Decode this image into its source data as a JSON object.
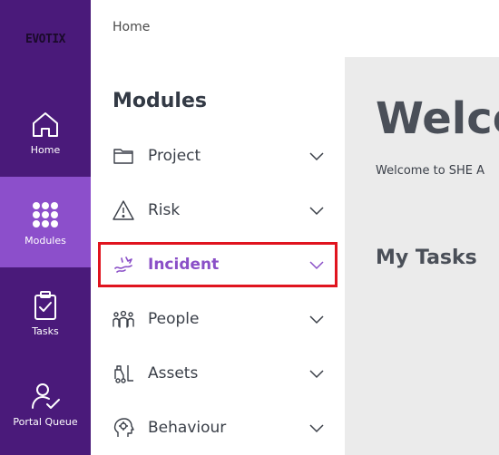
{
  "brand": {
    "logo_text": "EVOTIX"
  },
  "rail": {
    "items": [
      {
        "label": "Home",
        "icon": "home-icon"
      },
      {
        "label": "Modules",
        "icon": "grid-icon",
        "active": true
      },
      {
        "label": "Tasks",
        "icon": "clipboard-check-icon"
      },
      {
        "label": "Portal Queue",
        "icon": "user-check-icon"
      }
    ]
  },
  "breadcrumb": {
    "home": "Home"
  },
  "modules": {
    "title": "Modules",
    "items": [
      {
        "label": "Project",
        "icon": "folder-icon"
      },
      {
        "label": "Risk",
        "icon": "warning-icon"
      },
      {
        "label": "Incident",
        "icon": "incident-icon",
        "selected": true
      },
      {
        "label": "People",
        "icon": "people-icon"
      },
      {
        "label": "Assets",
        "icon": "forklift-icon"
      },
      {
        "label": "Behaviour",
        "icon": "brain-icon"
      }
    ]
  },
  "content": {
    "heading": "Welco",
    "subtitle": "Welcome to SHE A",
    "tasks_heading": "My Tasks"
  },
  "colors": {
    "rail_bg": "#4a1a7a",
    "rail_active": "#8c4fcb",
    "accent": "#8a4fc7",
    "highlight": "#e0141e"
  }
}
